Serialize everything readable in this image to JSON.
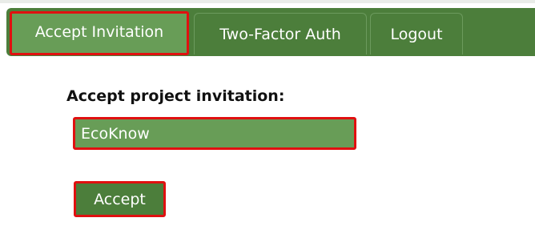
{
  "nav": {
    "tabs": [
      {
        "label": "Accept Invitation",
        "active": true
      },
      {
        "label": "Two-Factor Auth",
        "active": false
      },
      {
        "label": "Logout",
        "active": false
      }
    ]
  },
  "form": {
    "label": "Accept project invitation:",
    "project_value": "EcoKnow",
    "accept_label": "Accept"
  },
  "colors": {
    "nav_green": "#4c7e3b",
    "active_green": "#689d57",
    "highlight_red": "#e01010"
  }
}
